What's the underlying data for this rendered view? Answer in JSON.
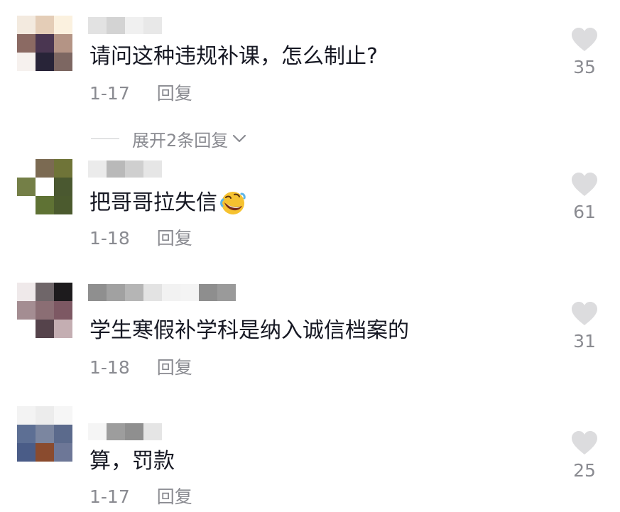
{
  "comments": [
    {
      "text": "请问这种违规补课，怎么制止?",
      "date": "1-17",
      "reply_label": "回复",
      "like_count": "35",
      "avatar_colors": [
        "#f3eadf",
        "#e4cdb7",
        "#fbf1df",
        "#8b6a63",
        "#4a3651",
        "#b49485",
        "#f6f1ee",
        "#282438",
        "#7d6762"
      ],
      "username_blocks": [
        "#e2e2e2",
        "#d3d3d3",
        "#f0f0f0",
        "#e8e8e8"
      ]
    },
    {
      "text": "把哥哥拉失信",
      "emoji": "rolling-on-floor-laughing-emoji",
      "date": "1-18",
      "reply_label": "回复",
      "like_count": "61",
      "avatar_colors": [
        "#ffffff",
        "#7b6a52",
        "#6f7438",
        "#747f47",
        "#ffffff",
        "#4a5830",
        "#ffffff",
        "#5f7234",
        "#4b5a2e"
      ],
      "username_blocks": [
        "#ebebeb",
        "#b9b9b9",
        "#cfcfcf",
        "#e6e6e6"
      ]
    },
    {
      "text": "学生寒假补学科是纳入诚信档案的",
      "date": "1-18",
      "reply_label": "回复",
      "like_count": "31",
      "avatar_colors": [
        "#efe9ea",
        "#6f6669",
        "#1d1b1d",
        "#a48d92",
        "#8b6e74",
        "#7d5863",
        "#ffffff",
        "#55434b",
        "#c4aeb2"
      ],
      "username_blocks": [
        "#8f8f8f",
        "#a1a1a1",
        "#b5b5b5",
        "#e3e3e3",
        "#f2f2f2",
        "#f4f4f4",
        "#8e8e8e",
        "#9a9a9a"
      ]
    },
    {
      "text": "算，罚款",
      "date": "1-17",
      "reply_label": "回复",
      "like_count": "25",
      "avatar_colors": [
        "#f3f3f3",
        "#ececec",
        "#f6f6f6",
        "#5d6f94",
        "#7b86a0",
        "#5b6a8c",
        "#4a5c87",
        "#8a4b2e",
        "#6d7797"
      ],
      "username_blocks": [
        "#f5f5f5",
        "#9d9d9d",
        "#8f8f8f",
        "#e5e5e5"
      ]
    }
  ],
  "expand_replies_label": "展开2条回复",
  "colors": {
    "text": "#161823",
    "meta": "#8a8b91",
    "heart": "#dcdcde"
  }
}
